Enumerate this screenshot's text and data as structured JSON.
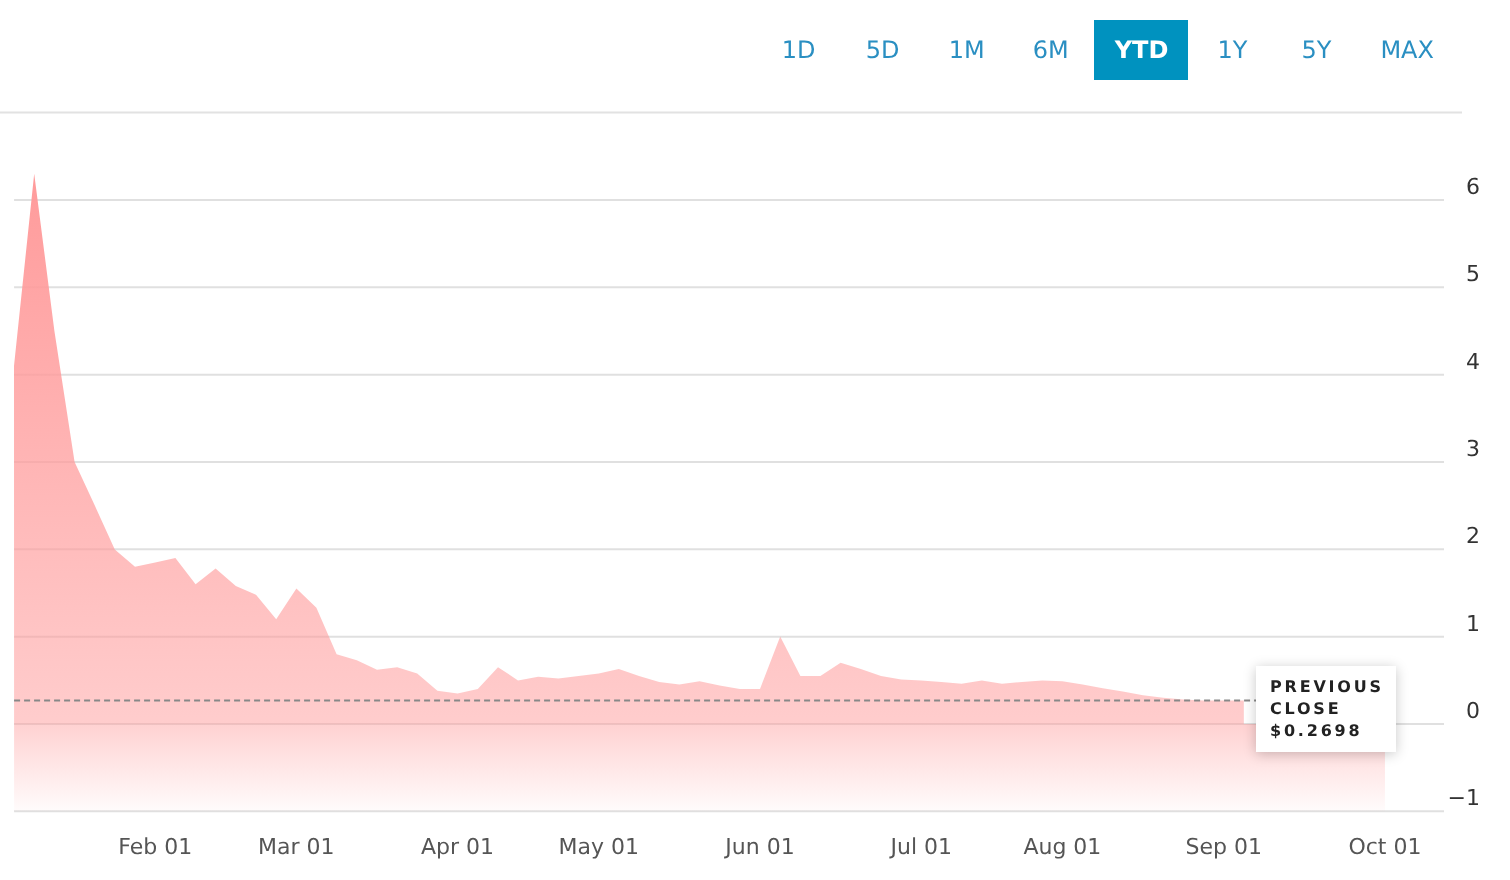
{
  "ranges": [
    {
      "label": "1D",
      "selected": false
    },
    {
      "label": "5D",
      "selected": false
    },
    {
      "label": "1M",
      "selected": false
    },
    {
      "label": "6M",
      "selected": false
    },
    {
      "label": "YTD",
      "selected": true
    },
    {
      "label": "1Y",
      "selected": false
    },
    {
      "label": "5Y",
      "selected": false
    },
    {
      "label": "MAX",
      "selected": false
    }
  ],
  "chart": {
    "chart_data": {
      "type": "area",
      "categories": [
        null,
        null,
        null,
        null,
        null,
        null,
        null,
        "Feb 01",
        null,
        null,
        null,
        null,
        null,
        null,
        "Mar 01",
        null,
        null,
        null,
        null,
        null,
        null,
        null,
        "Apr 01",
        null,
        null,
        null,
        null,
        null,
        null,
        "May 01",
        null,
        null,
        null,
        null,
        null,
        null,
        null,
        "Jun 01",
        null,
        null,
        null,
        null,
        null,
        null,
        null,
        "Jul 01",
        null,
        null,
        null,
        null,
        null,
        null,
        "Aug 01",
        null,
        null,
        null,
        null,
        null,
        null,
        null,
        "Sep 01",
        null,
        null,
        null,
        null,
        null,
        null,
        null,
        "Oct 01"
      ],
      "series": [
        {
          "color": "#ff9a9a",
          "values": [
            4.1,
            6.3,
            4.5,
            3.0,
            2.5,
            2.0,
            1.8,
            1.85,
            1.9,
            1.6,
            1.78,
            1.58,
            1.48,
            1.2,
            1.55,
            1.33,
            0.8,
            0.73,
            0.62,
            0.65,
            0.58,
            0.38,
            0.35,
            0.4,
            0.65,
            0.5,
            0.54,
            0.52,
            0.55,
            0.58,
            0.63,
            0.55,
            0.48,
            0.45,
            0.49,
            0.44,
            0.4,
            0.4,
            1.0,
            0.55,
            0.55,
            0.7,
            0.63,
            0.55,
            0.51,
            0.5,
            0.48,
            0.46,
            0.5,
            0.46,
            0.48,
            0.5,
            0.49,
            0.45,
            0.41,
            0.37,
            0.33,
            0.3,
            0.28,
            0.27,
            0.27,
            0.27,
            null,
            null,
            null,
            null,
            null,
            null,
            null
          ]
        }
      ],
      "grid": true,
      "ref_lines": [
        {
          "axis": "y",
          "value": 0.2698,
          "label": "$0.2698"
        }
      ],
      "ylim": [
        -1,
        7
      ],
      "yticks": [
        -1,
        0,
        1,
        2,
        3,
        4,
        5,
        6
      ]
    },
    "previous_close": {
      "label": "PREVIOUS CLOSE"
    }
  }
}
